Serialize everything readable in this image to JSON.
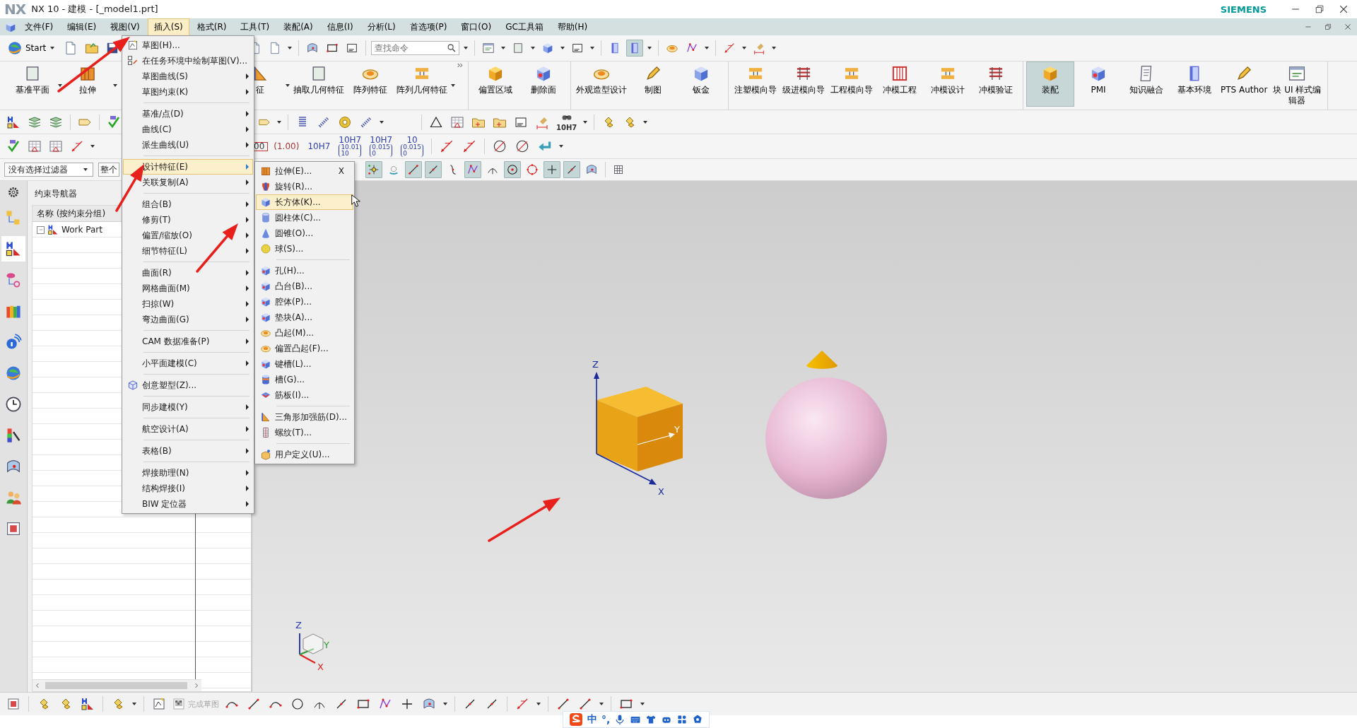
{
  "window": {
    "logo": "NX",
    "title": "NX 10 - 建模 - [_model1.prt]",
    "brand": "SIEMENS"
  },
  "menu_bar": [
    {
      "label": "文件(F)",
      "selected": false
    },
    {
      "label": "编辑(E)",
      "selected": false
    },
    {
      "label": "视图(V)",
      "selected": false
    },
    {
      "label": "插入(S)",
      "selected": true
    },
    {
      "label": "格式(R)",
      "selected": false
    },
    {
      "label": "工具(T)",
      "selected": false
    },
    {
      "label": "装配(A)",
      "selected": false
    },
    {
      "label": "信息(I)",
      "selected": false
    },
    {
      "label": "分析(L)",
      "selected": false
    },
    {
      "label": "首选项(P)",
      "selected": false
    },
    {
      "label": "窗口(O)",
      "selected": false
    },
    {
      "label": "GC工具箱",
      "selected": false
    },
    {
      "label": "帮助(H)",
      "selected": false
    }
  ],
  "toolbar": {
    "start": "Start",
    "search": {
      "placeholder": "查找命令"
    }
  },
  "ribbon": [
    {
      "items": [
        {
          "label": "基准平面",
          "selected": false
        },
        {
          "label": "拉伸",
          "selected": false
        }
      ]
    },
    {
      "items": [
        {
          "label": "征",
          "selected": false
        },
        {
          "label": "抽取几何特征",
          "selected": false
        },
        {
          "label": "阵列特征",
          "selected": false
        },
        {
          "label": "阵列几何特征",
          "selected": false
        }
      ]
    },
    {
      "items": [
        {
          "label": "偏置区域",
          "selected": false
        },
        {
          "label": "删除面",
          "selected": false
        }
      ]
    },
    {
      "items": [
        {
          "label": "外观造型设计",
          "selected": false
        },
        {
          "label": "制图",
          "selected": false
        },
        {
          "label": "钣金",
          "selected": false
        }
      ]
    },
    {
      "items": [
        {
          "label": "注塑模向导",
          "selected": false
        },
        {
          "label": "级进模向导",
          "selected": false
        },
        {
          "label": "工程模向导",
          "selected": false
        },
        {
          "label": "冲模工程",
          "selected": false
        },
        {
          "label": "冲模设计",
          "selected": false
        },
        {
          "label": "冲模验证",
          "selected": false
        }
      ]
    },
    {
      "items": [
        {
          "label": "装配",
          "selected": true
        },
        {
          "label": "PMI",
          "selected": false
        },
        {
          "label": "知识融合",
          "selected": false
        },
        {
          "label": "基本环境",
          "selected": false
        },
        {
          "label": "PTS Author",
          "selected": false
        },
        {
          "label": "块 UI 样式编辑器",
          "selected": false
        }
      ]
    }
  ],
  "pmi_toolbar": {
    "tolerance_label": "10H7"
  },
  "dimension_styles": [
    {
      "kind": "boxed",
      "main": "00"
    },
    {
      "kind": "plain",
      "main": "(1.00)"
    },
    {
      "kind": "plain",
      "main": "10H7"
    },
    {
      "kind": "stacked",
      "main": "10H7",
      "sub": [
        "10.01",
        "10"
      ]
    },
    {
      "kind": "stacked",
      "main": "10H7",
      "sub": [
        "0.015",
        "0"
      ]
    },
    {
      "kind": "stacked",
      "main": "10",
      "sub": [
        "0.015",
        "0"
      ]
    }
  ],
  "selection_bar": {
    "filter": "没有选择过滤器",
    "scope": "整个",
    "snaps": [
      {
        "on": true
      },
      {
        "on": false
      },
      {
        "on": true
      },
      {
        "on": true
      },
      {
        "on": false
      },
      {
        "on": true
      },
      {
        "on": false
      },
      {
        "on": true
      },
      {
        "on": false
      },
      {
        "on": true
      },
      {
        "on": true
      },
      {
        "on": false
      }
    ]
  },
  "resource_bar": [
    {
      "selected": false
    },
    {
      "selected": true
    },
    {
      "selected": false
    },
    {
      "selected": false
    },
    {
      "selected": false
    },
    {
      "selected": false
    },
    {
      "selected": false
    },
    {
      "selected": false
    },
    {
      "selected": false
    },
    {
      "selected": false
    },
    {
      "selected": false
    }
  ],
  "navigator": {
    "title": "约束导航器",
    "column": "名称 (按约束分组)",
    "tree": [
      {
        "label": "Work Part",
        "expanded": true
      }
    ]
  },
  "insert_menu": [
    {
      "kind": "item",
      "label": "草图(H)...",
      "submenu": false,
      "selected": false
    },
    {
      "kind": "item",
      "label": "在任务环境中绘制草图(V)...",
      "submenu": false,
      "selected": false
    },
    {
      "kind": "item",
      "label": "草图曲线(S)",
      "submenu": true,
      "selected": false
    },
    {
      "kind": "item",
      "label": "草图约束(K)",
      "submenu": true,
      "selected": false
    },
    {
      "kind": "separator"
    },
    {
      "kind": "item",
      "label": "基准/点(D)",
      "submenu": true,
      "selected": false
    },
    {
      "kind": "item",
      "label": "曲线(C)",
      "submenu": true,
      "selected": false
    },
    {
      "kind": "item",
      "label": "派生曲线(U)",
      "submenu": true,
      "selected": false
    },
    {
      "kind": "separator"
    },
    {
      "kind": "item",
      "label": "设计特征(E)",
      "submenu": true,
      "selected": true
    },
    {
      "kind": "item",
      "label": "关联复制(A)",
      "submenu": true,
      "selected": false
    },
    {
      "kind": "separator"
    },
    {
      "kind": "item",
      "label": "组合(B)",
      "submenu": true,
      "selected": false
    },
    {
      "kind": "item",
      "label": "修剪(T)",
      "submenu": true,
      "selected": false
    },
    {
      "kind": "item",
      "label": "偏置/缩放(O)",
      "submenu": true,
      "selected": false
    },
    {
      "kind": "item",
      "label": "细节特征(L)",
      "submenu": true,
      "selected": false
    },
    {
      "kind": "separator"
    },
    {
      "kind": "item",
      "label": "曲面(R)",
      "submenu": true,
      "selected": false
    },
    {
      "kind": "item",
      "label": "网格曲面(M)",
      "submenu": true,
      "selected": false
    },
    {
      "kind": "item",
      "label": "扫掠(W)",
      "submenu": true,
      "selected": false
    },
    {
      "kind": "item",
      "label": "弯边曲面(G)",
      "submenu": true,
      "selected": false
    },
    {
      "kind": "separator"
    },
    {
      "kind": "item",
      "label": "CAM 数据准备(P)",
      "submenu": true,
      "selected": false
    },
    {
      "kind": "separator"
    },
    {
      "kind": "item",
      "label": "小平面建模(C)",
      "submenu": true,
      "selected": false
    },
    {
      "kind": "separator"
    },
    {
      "kind": "item",
      "label": "创意塑型(Z)...",
      "submenu": false,
      "selected": false
    },
    {
      "kind": "separator"
    },
    {
      "kind": "item",
      "label": "同步建模(Y)",
      "submenu": true,
      "selected": false
    },
    {
      "kind": "separator"
    },
    {
      "kind": "item",
      "label": "航空设计(A)",
      "submenu": true,
      "selected": false
    },
    {
      "kind": "separator"
    },
    {
      "kind": "item",
      "label": "表格(B)",
      "submenu": true,
      "selected": false
    },
    {
      "kind": "separator"
    },
    {
      "kind": "item",
      "label": "焊接助理(N)",
      "submenu": true,
      "selected": false
    },
    {
      "kind": "item",
      "label": "结构焊接(I)",
      "submenu": true,
      "selected": false
    },
    {
      "kind": "item",
      "label": "BIW 定位器",
      "submenu": true,
      "selected": false
    }
  ],
  "design_feature_menu": [
    {
      "kind": "item",
      "label": "拉伸(E)...",
      "shortcut": "X",
      "selected": false
    },
    {
      "kind": "item",
      "label": "旋转(R)...",
      "selected": false
    },
    {
      "kind": "item",
      "label": "长方体(K)...",
      "selected": true
    },
    {
      "kind": "item",
      "label": "圆柱体(C)...",
      "selected": false
    },
    {
      "kind": "item",
      "label": "圆锥(O)...",
      "selected": false
    },
    {
      "kind": "item",
      "label": "球(S)...",
      "selected": false
    },
    {
      "kind": "separator"
    },
    {
      "kind": "item",
      "label": "孔(H)...",
      "selected": false
    },
    {
      "kind": "item",
      "label": "凸台(B)...",
      "selected": false
    },
    {
      "kind": "item",
      "label": "腔体(P)...",
      "selected": false
    },
    {
      "kind": "item",
      "label": "垫块(A)...",
      "selected": false
    },
    {
      "kind": "item",
      "label": "凸起(M)...",
      "selected": false
    },
    {
      "kind": "item",
      "label": "偏置凸起(F)...",
      "selected": false
    },
    {
      "kind": "item",
      "label": "键槽(L)...",
      "selected": false
    },
    {
      "kind": "item",
      "label": "槽(G)...",
      "selected": false
    },
    {
      "kind": "item",
      "label": "筋板(I)...",
      "selected": false
    },
    {
      "kind": "separator"
    },
    {
      "kind": "item",
      "label": "三角形加强筋(D)...",
      "selected": false
    },
    {
      "kind": "item",
      "label": "螺纹(T)...",
      "selected": false
    },
    {
      "kind": "separator"
    },
    {
      "kind": "item",
      "label": "用户定义(U)...",
      "selected": false
    }
  ],
  "graphics": {
    "axis_labels": [
      "Z",
      "Y",
      "X"
    ],
    "triad_labels": [
      "Z",
      "Y",
      "X"
    ]
  },
  "bottom_toolbar": {
    "finish_sketch": {
      "label": "完成草图",
      "disabled": true
    }
  },
  "ime_bar": {
    "mode": "中",
    "punctuation": "°,"
  }
}
